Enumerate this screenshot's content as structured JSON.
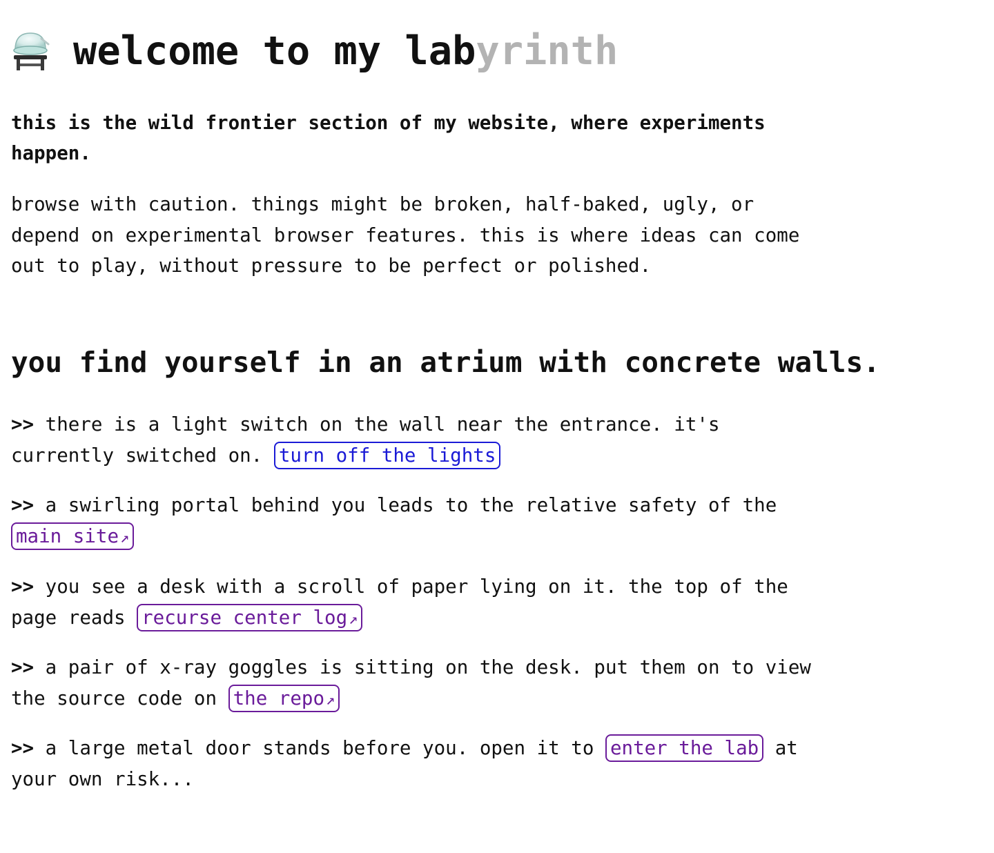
{
  "header": {
    "title_main": "welcome to my lab",
    "title_faded": "yrinth"
  },
  "intro": {
    "bold_text": "this is the wild frontier section of my website, where experiments\nhappen.",
    "body_text": "browse with caution. things might be broken, half-baked, ugly, or\ndepend on experimental browser features. this is where ideas can come\nout to play, without pressure to be perfect or polished."
  },
  "atrium": {
    "heading": "you find yourself in an atrium with concrete walls."
  },
  "items": [
    {
      "arrow": ">>",
      "text_before": " there is a light switch on the wall near the entrance. it's\ncurrently switched on. ",
      "link_label": "turn off the lights",
      "text_after": ""
    },
    {
      "arrow": ">>",
      "text_before": " a swirling portal behind you leads to the relative safety of the\n",
      "link_label": "main site",
      "link_icon": "↗",
      "text_after": ""
    },
    {
      "arrow": ">>",
      "text_before": " you see a desk with a scroll of paper lying on it. the top of the\npage reads ",
      "link_label": "recurse center log",
      "link_icon": "↗",
      "text_after": ""
    },
    {
      "arrow": ">>",
      "text_before": " a pair of x-ray goggles is sitting on the desk. put them on to view\nthe source code on ",
      "link_label": "the repo",
      "link_icon": "↗",
      "text_after": ""
    },
    {
      "arrow": ">>",
      "text_before": " a large metal door stands before you. open it to ",
      "link_label": "enter the lab",
      "text_after": " at\nyour own risk..."
    }
  ],
  "icons": {
    "header_icon": "alembic-icon",
    "external_link_icon": "external-link-icon"
  },
  "colors": {
    "text": "#111111",
    "faded": "#b3b3b3",
    "link_blue": "#1a1ad6",
    "link_purple": "#6a1b9a"
  }
}
